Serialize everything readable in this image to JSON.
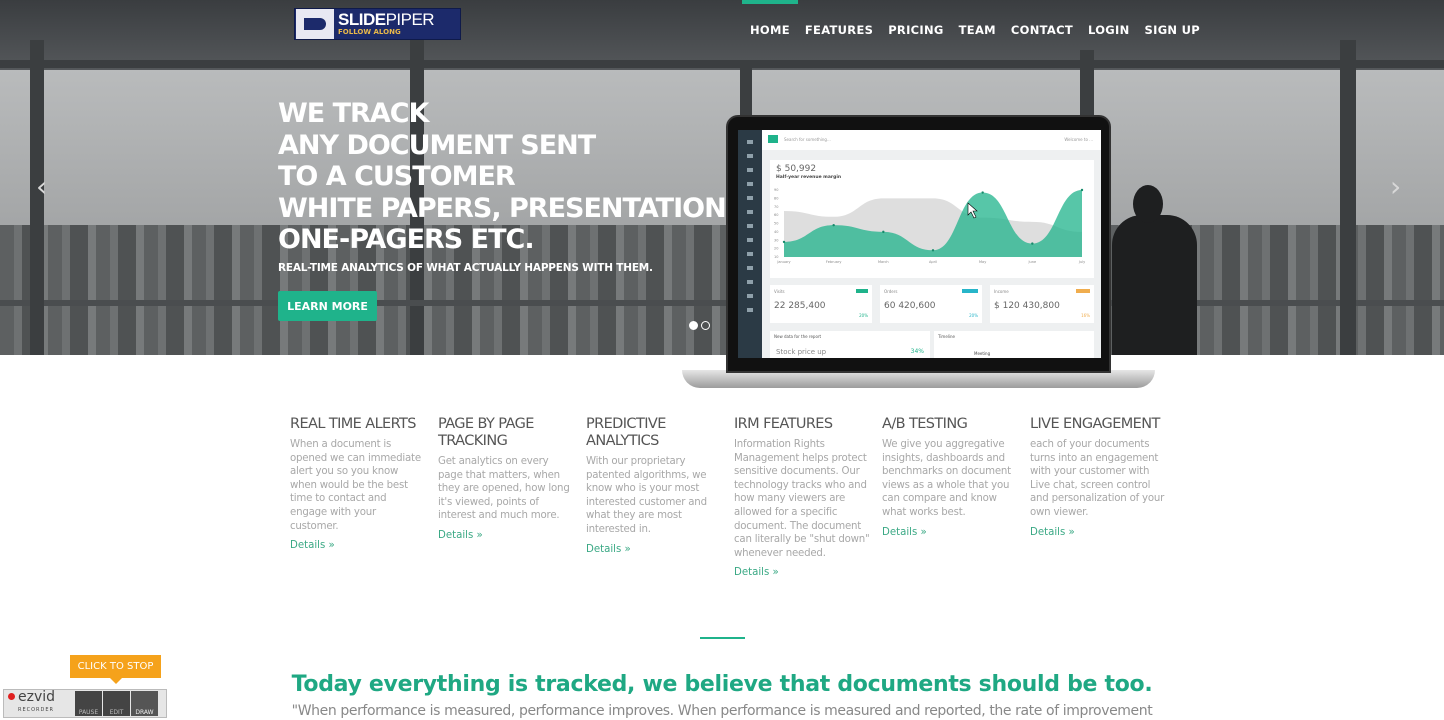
{
  "brand": {
    "name_bold": "SLIDE",
    "name_light": "PIPER",
    "tagline": "FOLLOW ALONG"
  },
  "nav": [
    {
      "label": "HOME",
      "active": true
    },
    {
      "label": "FEATURES"
    },
    {
      "label": "PRICING"
    },
    {
      "label": "TEAM"
    },
    {
      "label": "CONTACT"
    },
    {
      "label": "LOGIN"
    },
    {
      "label": "SIGN UP"
    }
  ],
  "hero": {
    "headline": [
      "WE TRACK",
      "ANY DOCUMENT SENT",
      "TO A CUSTOMER",
      "WHITE PAPERS, PRESENTATIONS",
      "ONE-PAGERS ETC."
    ],
    "subtitle": "REAL-TIME ANALYTICS OF WHAT ACTUALLY HAPPENS WITH THEM.",
    "cta": "LEARN MORE",
    "prev_icon": "chevron-left-icon",
    "next_icon": "chevron-right-icon",
    "slides_total": 2,
    "slide_active": 1
  },
  "dashboard": {
    "search_placeholder": "Search for something...",
    "welcome": "Welcome to ...",
    "revenue": "$ 50,992",
    "revenue_label": "Half-year revenue margin",
    "months": [
      "January",
      "February",
      "March",
      "April",
      "May",
      "June",
      "July"
    ],
    "y_ticks": [
      10,
      20,
      30,
      40,
      50,
      60,
      70,
      80,
      90
    ],
    "series_teal": [
      28,
      48,
      40,
      18,
      87,
      26,
      90
    ],
    "series_grey": [
      65,
      58,
      80,
      80,
      57,
      52,
      40
    ],
    "stats": [
      {
        "label": "Visits",
        "value": "22 285,400",
        "pct": "20%",
        "badge_color": "#1fb38b"
      },
      {
        "label": "Orders",
        "value": "60 420,600",
        "pct": "20%",
        "badge_color": "#27b5c9"
      },
      {
        "label": "Income",
        "value": "$ 120 430,800",
        "pct": "16%",
        "badge_color": "#f0ad4e"
      }
    ],
    "report_title": "New data for the report",
    "stock": "Stock price up",
    "stock_pct": "34%",
    "timeline": "Timeline",
    "meeting": "Meeting"
  },
  "features": [
    {
      "title": "REAL TIME ALERTS",
      "text": "When a document is opened we can immediate alert you so you know when would be the best time to contact and engage with your customer.",
      "link": "Details »"
    },
    {
      "title": "PAGE BY PAGE TRACKING",
      "text": "Get analytics on every page that matters, when they are opened, how long it's viewed, points of interest and much more.",
      "link": "Details »"
    },
    {
      "title": "PREDICTIVE ANALYTICS",
      "text": "With our proprietary patented algorithms, we know who is your most interested customer and what they are most interested in.",
      "link": "Details »"
    },
    {
      "title": "IRM FEATURES",
      "text": "Information Rights Management helps protect sensitive documents. Our technology tracks who and how many viewers are allowed for a specific document. The document can literally be \"shut down\" whenever needed.",
      "link": "Details »"
    },
    {
      "title": "A/B TESTING",
      "text": "We give you aggregative insights, dashboards and benchmarks on document views as a whole that you can compare and know what works best.",
      "link": "Details »"
    },
    {
      "title": "LIVE ENGAGEMENT",
      "text": "each of your documents turns into an engagement with your customer with Live chat, screen control and personalization of your own viewer.",
      "link": "Details »"
    }
  ],
  "tagline": "Today everything is tracked, we believe that documents should be too.",
  "quote": "\"When performance is measured, performance improves. When performance is measured and reported, the rate of improvement",
  "recorder": {
    "stop": "CLICK TO STOP",
    "logo": "ezvid",
    "logo_sub": "RECORDER",
    "buttons": [
      "PAUSE",
      "EDIT",
      "DRAW"
    ]
  },
  "colors": {
    "accent": "#1fb38b",
    "stop": "#f5a21b"
  }
}
